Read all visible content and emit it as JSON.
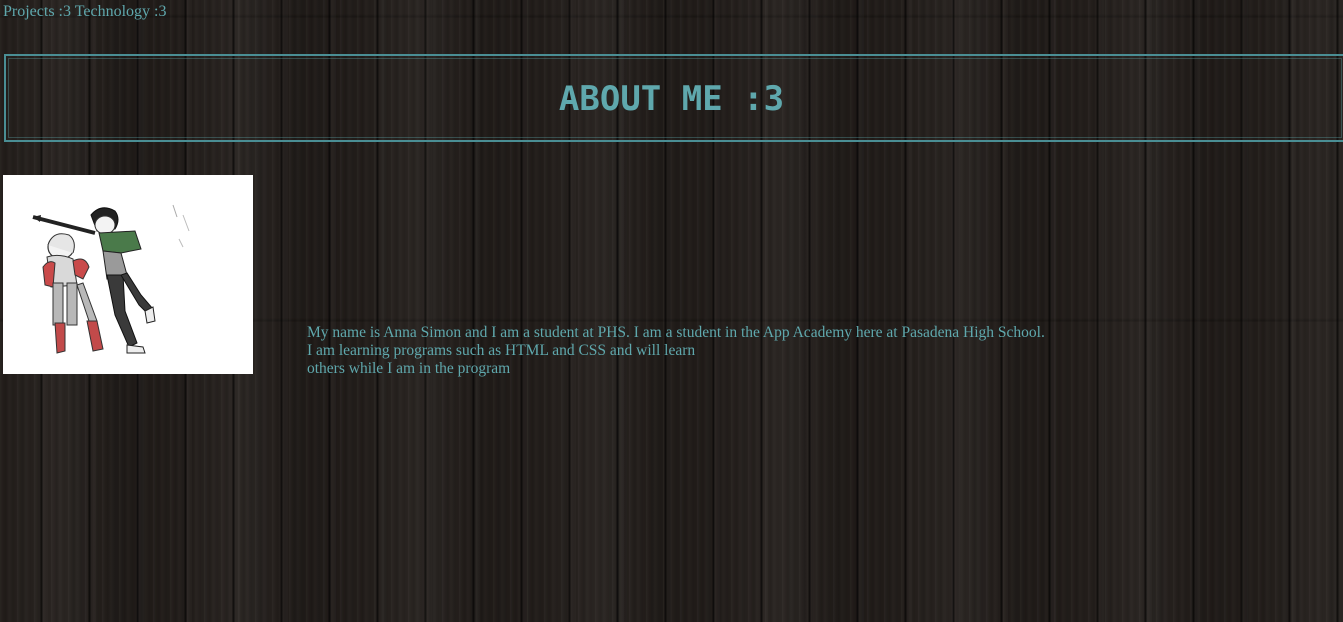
{
  "nav": {
    "links": [
      {
        "label": "Projects :3"
      },
      {
        "label": "Technology :3"
      }
    ]
  },
  "header": {
    "title": "ABOUT ME :3"
  },
  "photo": {
    "description_icon": "anime-illustration"
  },
  "bio": {
    "lines": [
      "My name is Anna Simon and I am a student at PHS. I am a student in the App Academy here at Pasadena High School.",
      "I am learning programs such as HTML and CSS and will learn",
      "others while I am in the program"
    ]
  },
  "colors": {
    "accent": "#5fa8ad",
    "background": "#221d1a",
    "border": "#4a8e94"
  }
}
